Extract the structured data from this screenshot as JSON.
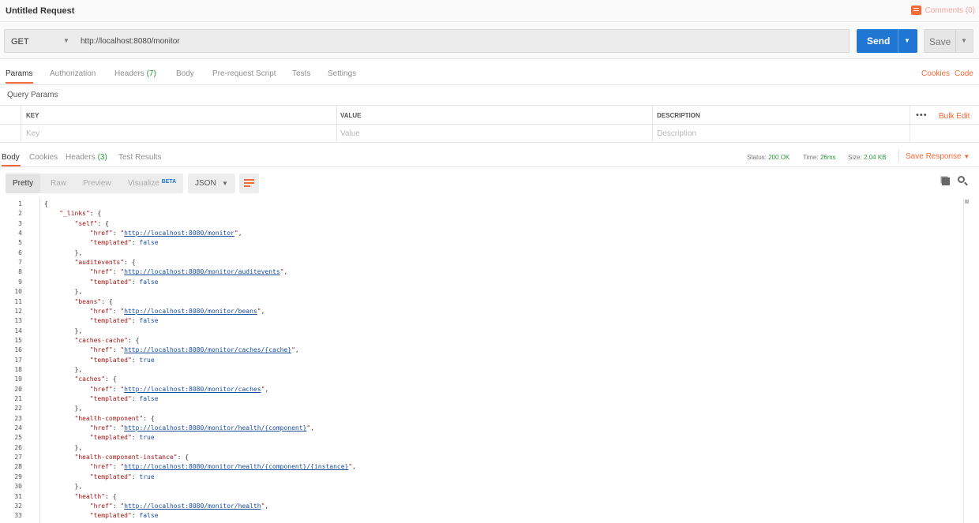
{
  "window": {
    "title": "Untitled Request",
    "comments_label": "Comments (0)"
  },
  "request": {
    "method": "GET",
    "url": "http://localhost:8080/monitor",
    "send_label": "Send",
    "save_label": "Save"
  },
  "request_tabs": {
    "params": "Params",
    "authorization": "Authorization",
    "headers": "Headers",
    "headers_count": "(7)",
    "body": "Body",
    "prerequest": "Pre-request Script",
    "tests": "Tests",
    "settings": "Settings",
    "cookies": "Cookies",
    "code": "Code"
  },
  "query_params": {
    "title": "Query Params",
    "columns": {
      "key": "KEY",
      "value": "VALUE",
      "description": "DESCRIPTION"
    },
    "placeholders": {
      "key": "Key",
      "value": "Value",
      "description": "Description"
    },
    "bulk_edit": "Bulk Edit",
    "more": "•••"
  },
  "response_tabs": {
    "body": "Body",
    "cookies": "Cookies",
    "headers": "Headers",
    "headers_count": "(3)",
    "test_results": "Test Results"
  },
  "response_status": {
    "status_label": "Status:",
    "status_value": "200 OK",
    "time_label": "Time:",
    "time_value": "26ms",
    "size_label": "Size:",
    "size_value": "2.04 KB",
    "save_response": "Save Response"
  },
  "view": {
    "pretty": "Pretty",
    "raw": "Raw",
    "preview": "Preview",
    "visualize": "Visualize",
    "beta": "BETA",
    "format": "JSON"
  },
  "response_lines": [
    "{",
    "    \"_links\": {",
    "        \"self\": {",
    "            \"href\": \"http://localhost:8080/monitor\",",
    "            \"templated\": false",
    "        },",
    "        \"auditevents\": {",
    "            \"href\": \"http://localhost:8080/monitor/auditevents\",",
    "            \"templated\": false",
    "        },",
    "        \"beans\": {",
    "            \"href\": \"http://localhost:8080/monitor/beans\",",
    "            \"templated\": false",
    "        },",
    "        \"caches-cache\": {",
    "            \"href\": \"http://localhost:8080/monitor/caches/{cache}\",",
    "            \"templated\": true",
    "        },",
    "        \"caches\": {",
    "            \"href\": \"http://localhost:8080/monitor/caches\",",
    "            \"templated\": false",
    "        },",
    "        \"health-component\": {",
    "            \"href\": \"http://localhost:8080/monitor/health/{component}\",",
    "            \"templated\": true",
    "        },",
    "        \"health-component-instance\": {",
    "            \"href\": \"http://localhost:8080/monitor/health/{component}/{instance}\",",
    "            \"templated\": true",
    "        },",
    "        \"health\": {",
    "            \"href\": \"http://localhost:8080/monitor/health\",",
    "            \"templated\": false",
    "        },"
  ],
  "colors": {
    "accent": "#f26b3a",
    "send": "#1f76d3",
    "ok": "#2b9a38"
  }
}
